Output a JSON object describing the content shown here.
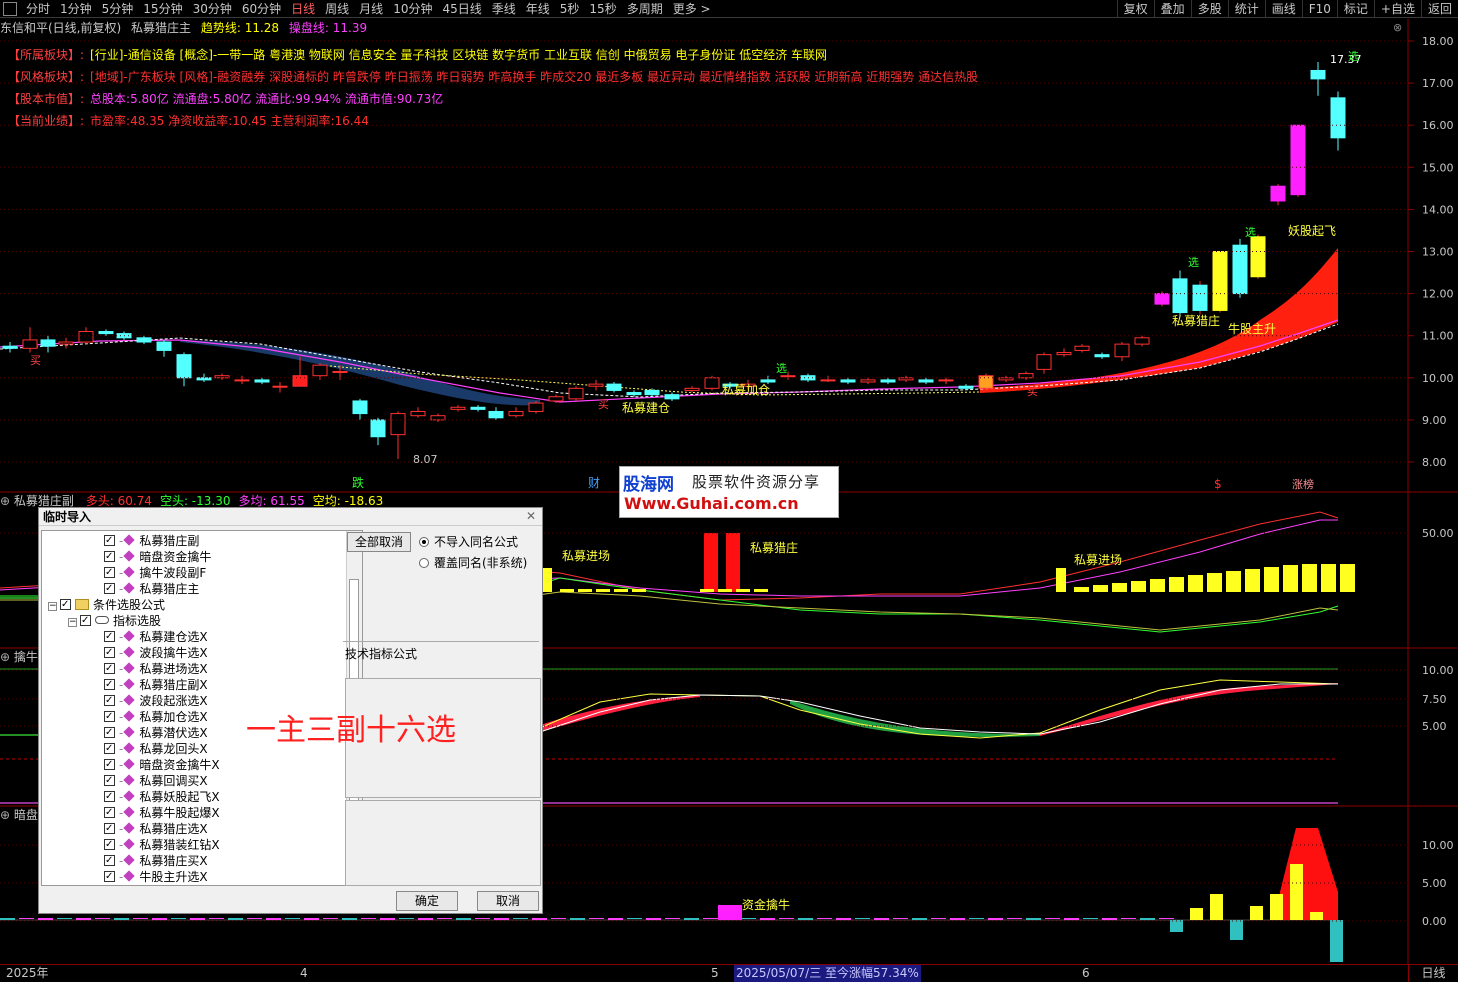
{
  "toolbar": {
    "periods": [
      "分时",
      "1分钟",
      "5分钟",
      "15分钟",
      "30分钟",
      "60分钟",
      "日线",
      "周线",
      "月线",
      "10分钟",
      "45日线",
      "季线",
      "年线",
      "5秒",
      "15秒",
      "多周期",
      "更多 >"
    ],
    "active_period": "日线",
    "right_buttons": [
      "复权",
      "叠加",
      "多股",
      "统计",
      "画线",
      "F10",
      "标记",
      "+自选",
      "返回"
    ]
  },
  "title": {
    "stock": "东信和平(日线,前复权)",
    "indicator": "私募猎庄主",
    "trend_label": "趋势线: 11.28",
    "trade_label": "操盘线: 11.39"
  },
  "info": [
    {
      "label": "【所属板块】:",
      "text": "[行业]-通信设备 [概念]-一带一路 粤港澳 物联网 信息安全 量子科技 区块链 数字货币 工业互联 信创 中俄贸易 电子身份证 低空经济 车联网",
      "color": "#ffff00"
    },
    {
      "label": "【风格板块】:",
      "text": "[地域]-广东板块 [风格]-融资融券 深股通标的 昨曾跌停 昨日振荡 昨日弱势 昨高换手 昨成交20 最近多板 最近异动 最近情绪指数 活跃股 近期新高 近期强势 通达信热股",
      "color": "#ff3030"
    },
    {
      "label": "【股本市值】:",
      "text": "总股本:5.80亿 流通盘:5.80亿 流通比:99.94% 流通市值:90.73亿",
      "color": "#ff40ff"
    },
    {
      "label": "【当前业绩】:",
      "text": "市盈率:48.35 净资收益率:10.45 主营利润率:16.44",
      "color": "#ff3030"
    }
  ],
  "main_axis": [
    "18.00",
    "17.00",
    "16.00",
    "15.00",
    "14.00",
    "13.00",
    "12.00",
    "11.00",
    "10.00",
    "9.00",
    "8.00"
  ],
  "chart_labels": {
    "low": "8.07",
    "high": "17.37",
    "buy1": "买",
    "buy2": "买",
    "buy3": "买",
    "jiancang": "私募建仓",
    "jiacang": "私募加仓",
    "xuan1": "选",
    "xuan2": "选",
    "xuan3": "选",
    "xuan4": "选",
    "lie_zhuang": "私募猎庄",
    "niu_gu": "牛股主升",
    "yao_gu": "妖股起飞",
    "die": "跌",
    "cai": "财",
    "dollar": "$",
    "zhang_bang": "涨榜"
  },
  "panel1": {
    "name": "私募猎庄副",
    "values": [
      {
        "text": "多头: 60.74",
        "color": "#ff3030"
      },
      {
        "text": "空头: -13.30",
        "color": "#30ff30"
      },
      {
        "text": "多均: 61.55",
        "color": "#ff40ff"
      },
      {
        "text": "空均: -18.63",
        "color": "#ffff00"
      }
    ],
    "axis": [
      "50.00"
    ],
    "labels": {
      "jinchang1": "私募进场",
      "liezhuang": "私募猎庄",
      "jinchang2": "私募进场"
    }
  },
  "panel2": {
    "name": "擒牛",
    "axis": [
      "10.00",
      "7.50",
      "5.00"
    ]
  },
  "panel3": {
    "name": "暗盘",
    "axis": [
      "10.00",
      "5.00",
      "0.00"
    ],
    "labels": {
      "zijin": "资金擒牛"
    }
  },
  "watermark": {
    "line1": "股海网",
    "line1b": "股票软件资源分享",
    "line2": "Www.Guhai.com.cn"
  },
  "dialog": {
    "title": "临时导入",
    "tree": [
      {
        "label": "私募猎庄副",
        "level": 3,
        "type": "item"
      },
      {
        "label": "暗盘资金擒牛",
        "level": 3,
        "type": "item"
      },
      {
        "label": "擒牛波段副F",
        "level": 3,
        "type": "item"
      },
      {
        "label": "私募猎庄主",
        "level": 3,
        "type": "item"
      },
      {
        "label": "条件选股公式",
        "level": 1,
        "type": "folder"
      },
      {
        "label": "指标选股",
        "level": 2,
        "type": "key"
      },
      {
        "label": "私募建仓选X",
        "level": 3,
        "type": "item"
      },
      {
        "label": "波段擒牛选X",
        "level": 3,
        "type": "item"
      },
      {
        "label": "私募进场选X",
        "level": 3,
        "type": "item"
      },
      {
        "label": "私募猎庄副X",
        "level": 3,
        "type": "item"
      },
      {
        "label": "波段起涨选X",
        "level": 3,
        "type": "item"
      },
      {
        "label": "私募加仓选X",
        "level": 3,
        "type": "item"
      },
      {
        "label": "私募潜伏选X",
        "level": 3,
        "type": "item"
      },
      {
        "label": "私募龙回头X",
        "level": 3,
        "type": "item"
      },
      {
        "label": "暗盘资金擒牛X",
        "level": 3,
        "type": "item"
      },
      {
        "label": "私募回调买X",
        "level": 3,
        "type": "item"
      },
      {
        "label": "私募妖股起飞X",
        "level": 3,
        "type": "item"
      },
      {
        "label": "私募牛股起爆X",
        "level": 3,
        "type": "item"
      },
      {
        "label": "私募猎庄选X",
        "level": 3,
        "type": "item"
      },
      {
        "label": "私募猎装红钻X",
        "level": 3,
        "type": "item"
      },
      {
        "label": "私募猎庄买X",
        "level": 3,
        "type": "item"
      },
      {
        "label": "牛股主升选X",
        "level": 3,
        "type": "item"
      }
    ],
    "cancel_all": "全部取消",
    "radio1": "不导入同名公式",
    "radio2": "覆盖同名(非系统)",
    "group": "技术指标公式",
    "ok": "确定",
    "cancel": "取消"
  },
  "overlay_text": "一主三副十六选",
  "dates": {
    "d0": "2025年",
    "d1": "4",
    "d2": "5",
    "d3": "2025/05/07/三  至今涨幅57.34%",
    "d4": "6"
  },
  "day_button": "日线"
}
